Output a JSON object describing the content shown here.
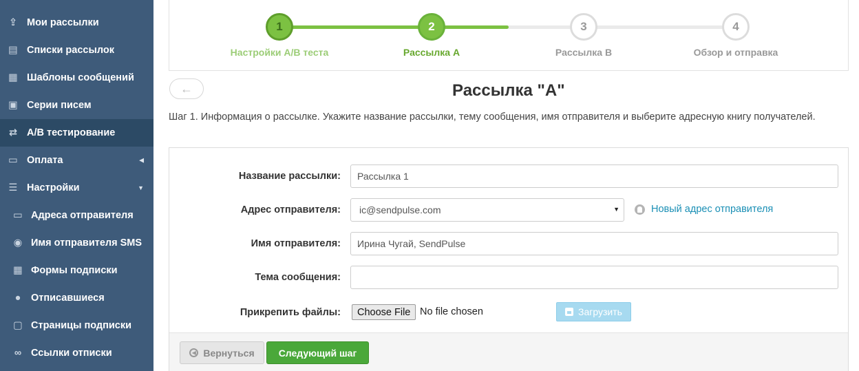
{
  "sidebar": {
    "items": [
      {
        "label": "Мои рассылки",
        "icon": "send-icon"
      },
      {
        "label": "Списки рассылок",
        "icon": "address-book-icon"
      },
      {
        "label": "Шаблоны сообщений",
        "icon": "template-icon"
      },
      {
        "label": "Серии писем",
        "icon": "series-icon"
      },
      {
        "label": "A/B тестирование",
        "icon": "ab-test-icon",
        "active": true
      },
      {
        "label": "Оплата",
        "icon": "wallet-icon",
        "caret": "◀"
      },
      {
        "label": "Настройки",
        "icon": "sliders-icon",
        "caret": "▼"
      },
      {
        "label": "Адреса отправителя",
        "icon": "id-card-icon",
        "sub": true
      },
      {
        "label": "Имя отправителя SMS",
        "icon": "user-circle-icon",
        "sub": true
      },
      {
        "label": "Формы подписки",
        "icon": "form-icon",
        "sub": true
      },
      {
        "label": "Отписавшиеся",
        "icon": "user-icon",
        "sub": true
      },
      {
        "label": "Страницы подписки",
        "icon": "page-icon",
        "sub": true
      },
      {
        "label": "Ссылки отписки",
        "icon": "link-icon",
        "sub": true
      }
    ]
  },
  "stepper": {
    "steps": [
      {
        "number": "1",
        "label": "Настройки A/B теста",
        "state": "done"
      },
      {
        "number": "2",
        "label": "Рассылка A",
        "state": "current"
      },
      {
        "number": "3",
        "label": "Рассылка B",
        "state": "pending"
      },
      {
        "number": "4",
        "label": "Обзор и отправка",
        "state": "pending"
      }
    ]
  },
  "page": {
    "back_arrow": "←",
    "title": "Рассылка \"A\"",
    "description": "Шаг 1. Информация о рассылке. Укажите название рассылки, тему сообщения, имя отправителя и выберите адресную книгу получателей."
  },
  "form": {
    "name_label": "Название рассылки:",
    "name_value": "Рассылка 1",
    "sender_label": "Адрес отправителя:",
    "sender_value": "ic@sendpulse.com",
    "new_sender_link": "Новый адрес отправителя",
    "sender_name_label": "Имя отправителя:",
    "sender_name_value": "Ирина Чугай, SendPulse",
    "subject_label": "Тема сообщения:",
    "subject_value": "",
    "attach_label": "Прикрепить файлы:",
    "choose_file": "Choose File",
    "no_file": "No file chosen",
    "upload_label": "Загрузить"
  },
  "footer": {
    "back_label": "Вернуться",
    "next_label": "Следующий шаг"
  },
  "colors": {
    "sidebar_bg": "#3e5b7a",
    "sidebar_active": "#2c4a65",
    "accent_green": "#7cc142",
    "button_green": "#4aa83a",
    "link_blue": "#1a8fb5"
  }
}
